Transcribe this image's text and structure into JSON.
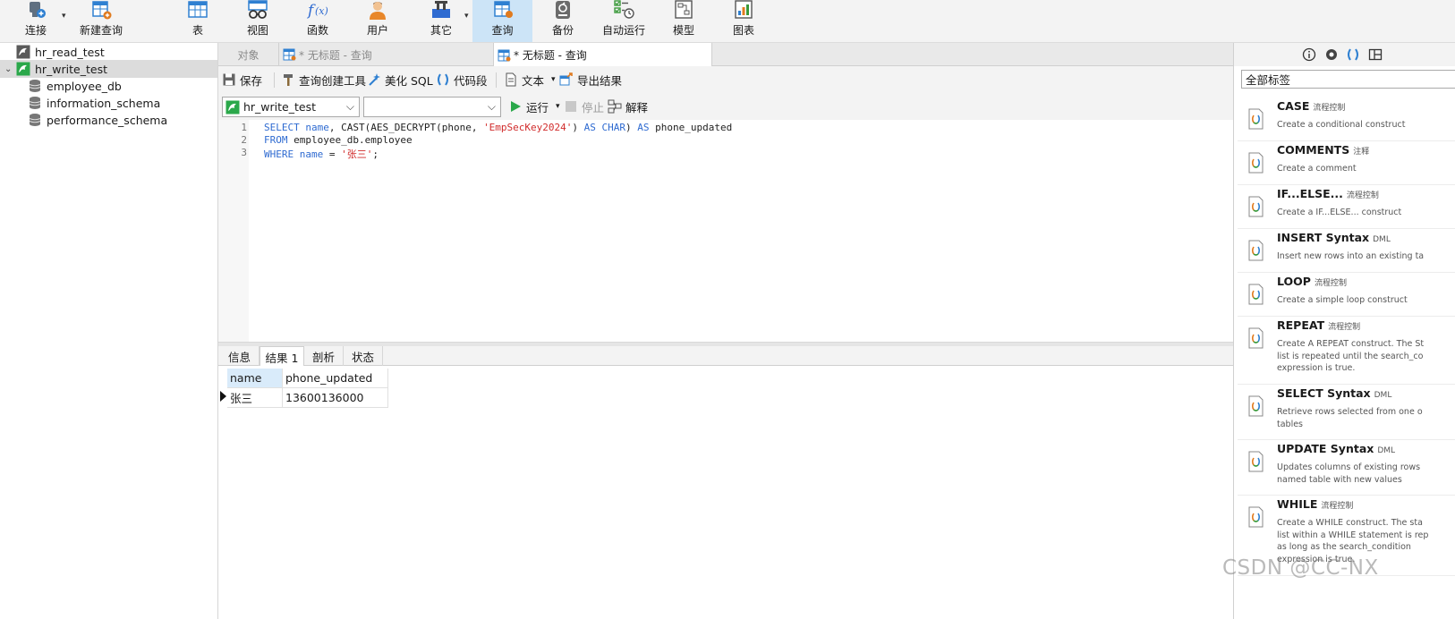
{
  "toolbar": {
    "items": [
      {
        "label": "连接",
        "icon": "plug-icon"
      },
      {
        "label": "新建查询",
        "icon": "new-query-icon"
      },
      {
        "label": "表",
        "icon": "table-icon"
      },
      {
        "label": "视图",
        "icon": "view-icon"
      },
      {
        "label": "函数",
        "icon": "function-icon"
      },
      {
        "label": "用户",
        "icon": "user-icon"
      },
      {
        "label": "其它",
        "icon": "other-icon"
      },
      {
        "label": "查询",
        "icon": "query-icon",
        "active": true
      },
      {
        "label": "备份",
        "icon": "backup-icon"
      },
      {
        "label": "自动运行",
        "icon": "auto-run-icon"
      },
      {
        "label": "模型",
        "icon": "model-icon"
      },
      {
        "label": "图表",
        "icon": "chart-icon"
      }
    ]
  },
  "nav": {
    "items": [
      {
        "label": "hr_read_test",
        "level": 0
      },
      {
        "label": "hr_write_test",
        "level": 0,
        "expanded": true,
        "selected": true
      },
      {
        "label": "employee_db",
        "level": 1
      },
      {
        "label": "information_schema",
        "level": 1
      },
      {
        "label": "performance_schema",
        "level": 1
      }
    ]
  },
  "tabs": [
    {
      "label": "对象"
    },
    {
      "label": "* 无标题 - 查询"
    },
    {
      "label": "* 无标题 - 查询",
      "active": true
    }
  ],
  "edit_toolbar": {
    "save": "保存",
    "query_builder": "查询创建工具",
    "beautify": "美化 SQL",
    "snippet": "代码段",
    "text": "文本",
    "export": "导出结果"
  },
  "run_toolbar": {
    "connection": "hr_write_test",
    "database": "",
    "run": "运行",
    "stop": "停止",
    "explain": "解释"
  },
  "editor": {
    "line_numbers": [
      "1",
      "2",
      "3"
    ],
    "lines": [
      [
        {
          "t": "SELECT",
          "c": "kw"
        },
        {
          "t": " "
        },
        {
          "t": "name",
          "c": "kw"
        },
        {
          "t": ", CAST(AES_DECRYPT(phone, "
        },
        {
          "t": "'EmpSecKey2024'",
          "c": "str"
        },
        {
          "t": ") "
        },
        {
          "t": "AS",
          "c": "kw"
        },
        {
          "t": " "
        },
        {
          "t": "CHAR",
          "c": "kw"
        },
        {
          "t": ") "
        },
        {
          "t": "AS",
          "c": "kw"
        },
        {
          "t": " phone_updated"
        }
      ],
      [
        {
          "t": "FROM",
          "c": "kw"
        },
        {
          "t": " employee_db.employee"
        }
      ],
      [
        {
          "t": "WHERE",
          "c": "kw"
        },
        {
          "t": " "
        },
        {
          "t": "name",
          "c": "kw"
        },
        {
          "t": " = "
        },
        {
          "t": "'张三'",
          "c": "str"
        },
        {
          "t": ";"
        }
      ]
    ]
  },
  "result_tabs": [
    {
      "label": "信息"
    },
    {
      "label": "结果 1",
      "active": true
    },
    {
      "label": "剖析"
    },
    {
      "label": "状态"
    }
  ],
  "result_grid": {
    "columns": [
      "name",
      "phone_updated"
    ],
    "rows": [
      [
        "张三",
        "13600136000"
      ]
    ]
  },
  "snippets": {
    "filter_value": "全部标签",
    "items": [
      {
        "title": "CASE",
        "tag": "流程控制",
        "desc": "Create a conditional construct"
      },
      {
        "title": "COMMENTS",
        "tag": "注释",
        "desc": "Create a comment"
      },
      {
        "title": "IF...ELSE...",
        "tag": "流程控制",
        "desc": "Create a IF...ELSE... construct"
      },
      {
        "title": "INSERT Syntax",
        "tag": "DML",
        "desc": "Insert new rows into an existing ta"
      },
      {
        "title": "LOOP",
        "tag": "流程控制",
        "desc": "Create a simple loop construct"
      },
      {
        "title": "REPEAT",
        "tag": "流程控制",
        "desc": "Create A REPEAT construct. The St\nlist is repeated until the search_co\nexpression is true."
      },
      {
        "title": "SELECT Syntax",
        "tag": "DML",
        "desc": "Retrieve rows selected from one o\ntables"
      },
      {
        "title": "UPDATE Syntax",
        "tag": "DML",
        "desc": "Updates columns of existing rows\nnamed table with new values"
      },
      {
        "title": "WHILE",
        "tag": "流程控制",
        "desc": "Create a WHILE construct. The sta\nlist within a WHILE statement is rep\nas long as the search_condition\nexpression is true."
      }
    ]
  },
  "watermark": "CSDN @CC-NX",
  "colors": {
    "keyword": "#2f6bd1",
    "string": "#d12c2c",
    "active_tab": "#cce4f7",
    "connection_green": "#2aa84a"
  }
}
